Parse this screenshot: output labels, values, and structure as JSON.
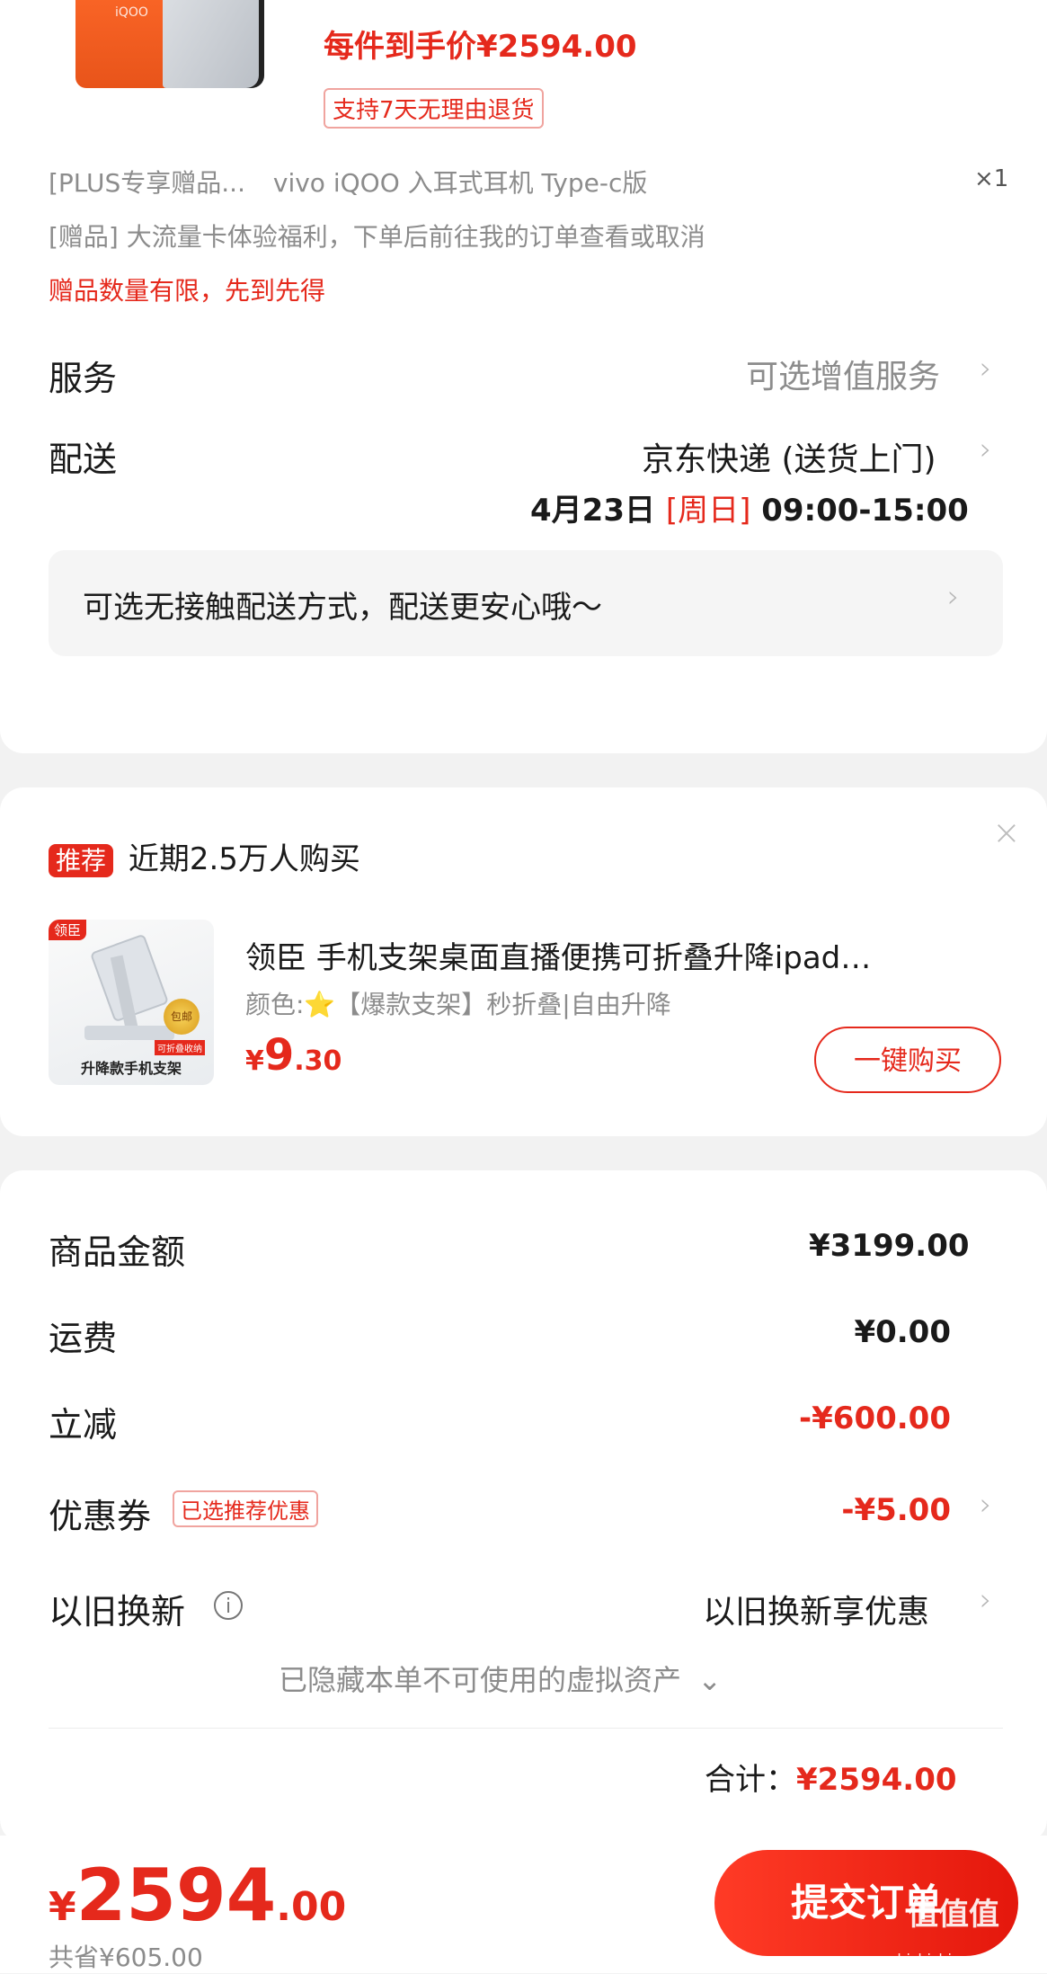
{
  "product": {
    "price_each_label": "每件到手价¥2594.00",
    "return_tag": "支持7天无理由退货",
    "phone_logo": "iQOO",
    "gift_line1_prefix": "[PLUS专享赠品...",
    "gift_line1_name": "vivo iQOO 入耳式耳机 Type-c版",
    "gift_line1_qty": "×1",
    "gift_line2": "[赠品] 大流量卡体验福利，下单后前往我的订单查看或取消",
    "gift_notice": "赠品数量有限，先到先得"
  },
  "service": {
    "label": "服务",
    "value": "可选增值服务"
  },
  "delivery": {
    "label": "配送",
    "method": "京东快递 (送货上门)",
    "date": "4月23日",
    "weekday": "[周日]",
    "time": "09:00-15:00",
    "contactless": "可选无接触配送方式，配送更安心哦～"
  },
  "recommend": {
    "badge": "推荐",
    "headline": "近期2.5万人购买",
    "item": {
      "brand_badge": "领臣",
      "image_caption": "升降款手机支架",
      "seal_text": "包邮",
      "image_tag": "可折叠收纳",
      "title": "领臣 手机支架桌面直播便携可折叠升降ipad…",
      "spec": "颜色:⭐【爆款支架】秒折叠|自由升降",
      "price_symbol": "¥",
      "price_int": "9",
      "price_dec": ".30",
      "buy_button": "一键购买"
    }
  },
  "summary": {
    "rows": [
      {
        "label": "商品金额",
        "value": "¥3199.00"
      },
      {
        "label": "运费",
        "value": "¥0.00"
      },
      {
        "label": "立减",
        "value": "-¥600.00"
      }
    ],
    "coupon": {
      "label": "优惠券",
      "tag": "已选推荐优惠",
      "value": "-¥5.00"
    },
    "tradein": {
      "label": "以旧换新",
      "value": "以旧换新享优惠"
    },
    "hidden_assets": "已隐藏本单不可使用的虚拟资产",
    "total_label": "合计：",
    "total_value": "¥2594.00"
  },
  "bottom": {
    "currency": "¥",
    "amount_int": "2594",
    "amount_dec": ".00",
    "saved": "共省¥605.00",
    "submit": "提交订单",
    "watermark": "值值值",
    "watermark_sub": "zhizhizhi.com"
  },
  "colors": {
    "accent": "#e5291c",
    "background": "#f2f2f2",
    "card": "#ffffff"
  }
}
